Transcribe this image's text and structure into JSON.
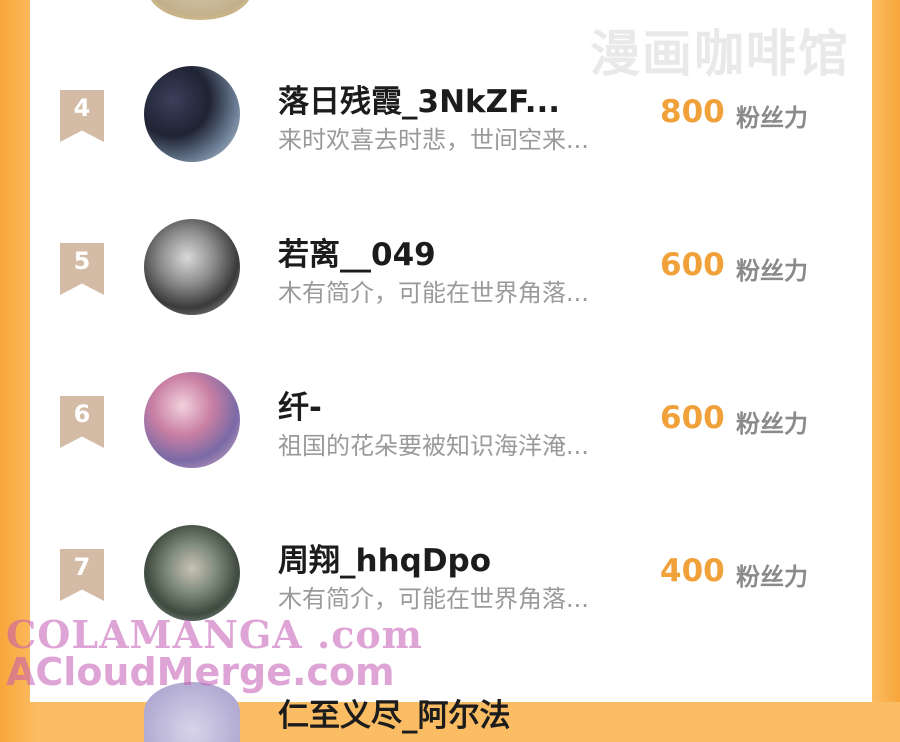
{
  "watermark_top": "漫画咖啡馆",
  "score_unit": "粉丝力",
  "rows": [
    {
      "rank": "4",
      "name": "落日残霞_3NkZF...",
      "bio": "来时欢喜去时悲，世间空来...",
      "score": "800"
    },
    {
      "rank": "5",
      "name": "若离__049",
      "bio": "木有简介，可能在世界角落...",
      "score": "600"
    },
    {
      "rank": "6",
      "name": "纤-",
      "bio": "祖国的花朵要被知识海洋淹...",
      "score": "600"
    },
    {
      "rank": "7",
      "name": "周翔_hhqDpo",
      "bio": "木有简介，可能在世界角落...",
      "score": "400"
    }
  ],
  "partial_row": {
    "name": "仁至义尽_阿尔法"
  },
  "watermark_bottom": {
    "line1": "COLAMANGA .com",
    "line2": "ACloudMerge.com"
  },
  "colors": {
    "accent": "#f1a13a",
    "rank_badge": "#d3bba6",
    "side_orange": "#f7a63a"
  }
}
